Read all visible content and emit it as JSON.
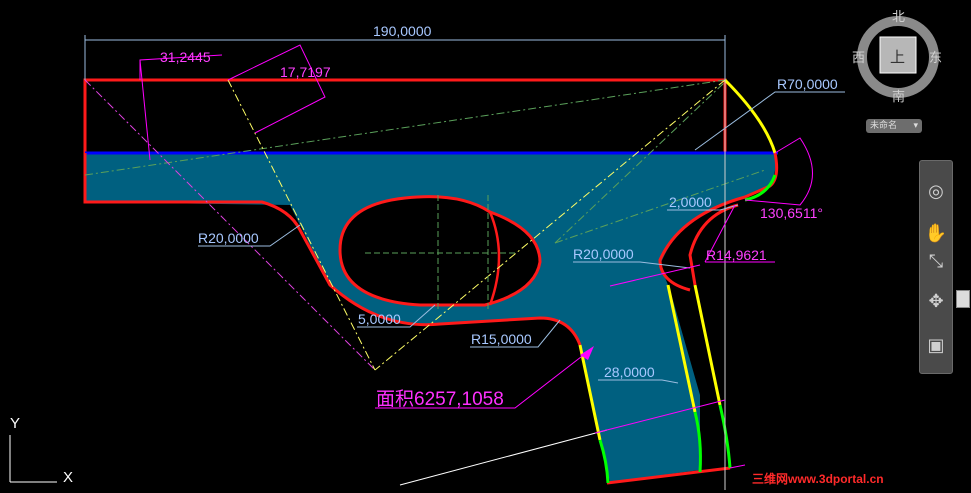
{
  "drawing": {
    "dimensions": {
      "overall_width": "190,0000",
      "angle_offset": "31,2445",
      "angle_offset2": "17,7197",
      "radius_top_right": "R70,0000",
      "gap": "2,0000",
      "angle_right": "130,6511°",
      "radius_left": "R20,0000",
      "radius_inner": "R20,0000",
      "radius_small": "R14,9621",
      "slot_offset": "5,0000",
      "radius_trigger": "R15,0000",
      "grip_width": "28,0000"
    },
    "area_label": "面积6257,1058",
    "colors": {
      "fill": "#006080",
      "outline": "#ff0000",
      "blue_edge": "#0000ff",
      "yellow": "#ffff00",
      "green": "#00ff00",
      "magenta": "#ff00ff",
      "dim_line": "#9bbde0",
      "dim_text": "#a8c8ff"
    }
  },
  "viewcube": {
    "north": "北",
    "south": "南",
    "east": "东",
    "west": "西",
    "face": "上",
    "wcs_label": "未命名"
  },
  "ucs": {
    "y_axis": "Y",
    "x_axis": "X"
  },
  "nav_bar": {
    "tools": [
      "steering-wheel-icon",
      "pan-icon",
      "zoom-icon",
      "orbit-icon",
      "showmotion-icon"
    ]
  },
  "watermark": "三维网www.3dportal.cn"
}
